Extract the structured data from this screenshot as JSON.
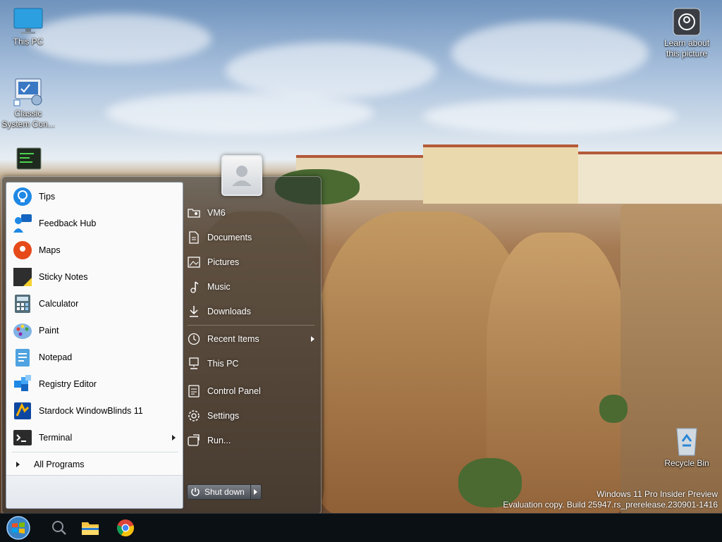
{
  "desktop": {
    "icons": [
      {
        "label": "This PC",
        "icon": "monitor-icon"
      },
      {
        "label": "Classic System Con...",
        "icon": "control-panel-icon"
      },
      {
        "label": "",
        "icon": "terminal-shortcut-icon"
      },
      {
        "label": "Learn about this picture",
        "icon": "camera-icon"
      },
      {
        "label": "Recycle Bin",
        "icon": "recycle-bin-icon"
      }
    ],
    "watermark": {
      "line1": "Windows 11 Pro Insider Preview",
      "line2": "Evaluation copy. Build 25947.rs_prerelease.230901-1416"
    }
  },
  "start_menu": {
    "programs": [
      {
        "label": "Tips",
        "icon": "lightbulb-icon"
      },
      {
        "label": "Feedback Hub",
        "icon": "feedback-hub-icon"
      },
      {
        "label": "Maps",
        "icon": "map-pin-icon"
      },
      {
        "label": "Sticky Notes",
        "icon": "sticky-note-icon"
      },
      {
        "label": "Calculator",
        "icon": "calculator-icon"
      },
      {
        "label": "Paint",
        "icon": "paint-palette-icon"
      },
      {
        "label": "Notepad",
        "icon": "notepad-icon"
      },
      {
        "label": "Registry Editor",
        "icon": "registry-editor-icon"
      },
      {
        "label": "Stardock WindowBlinds 11",
        "icon": "windowblinds-icon"
      },
      {
        "label": "Terminal",
        "icon": "terminal-icon"
      }
    ],
    "all_programs": "All Programs",
    "right_items": [
      {
        "label": "VM6",
        "icon": "user-folder-icon"
      },
      {
        "label": "Documents",
        "icon": "document-icon"
      },
      {
        "label": "Pictures",
        "icon": "picture-icon"
      },
      {
        "label": "Music",
        "icon": "music-note-icon"
      },
      {
        "label": "Downloads",
        "icon": "download-icon"
      },
      {
        "label": "Recent Items",
        "icon": "clock-icon"
      },
      {
        "label": "This PC",
        "icon": "computer-icon"
      },
      {
        "label": "Control Panel",
        "icon": "control-panel-icon"
      },
      {
        "label": "Settings",
        "icon": "gear-icon"
      },
      {
        "label": "Run...",
        "icon": "run-icon"
      }
    ],
    "shutdown_label": "Shut down"
  },
  "taskbar": {
    "items": [
      "start-orb-icon",
      "search-icon",
      "file-explorer-icon",
      "chrome-icon"
    ]
  },
  "colors": {
    "taskbar": "#0b1014",
    "start_menu_glass": "#282c30",
    "accent_blue": "#1e88e5"
  }
}
